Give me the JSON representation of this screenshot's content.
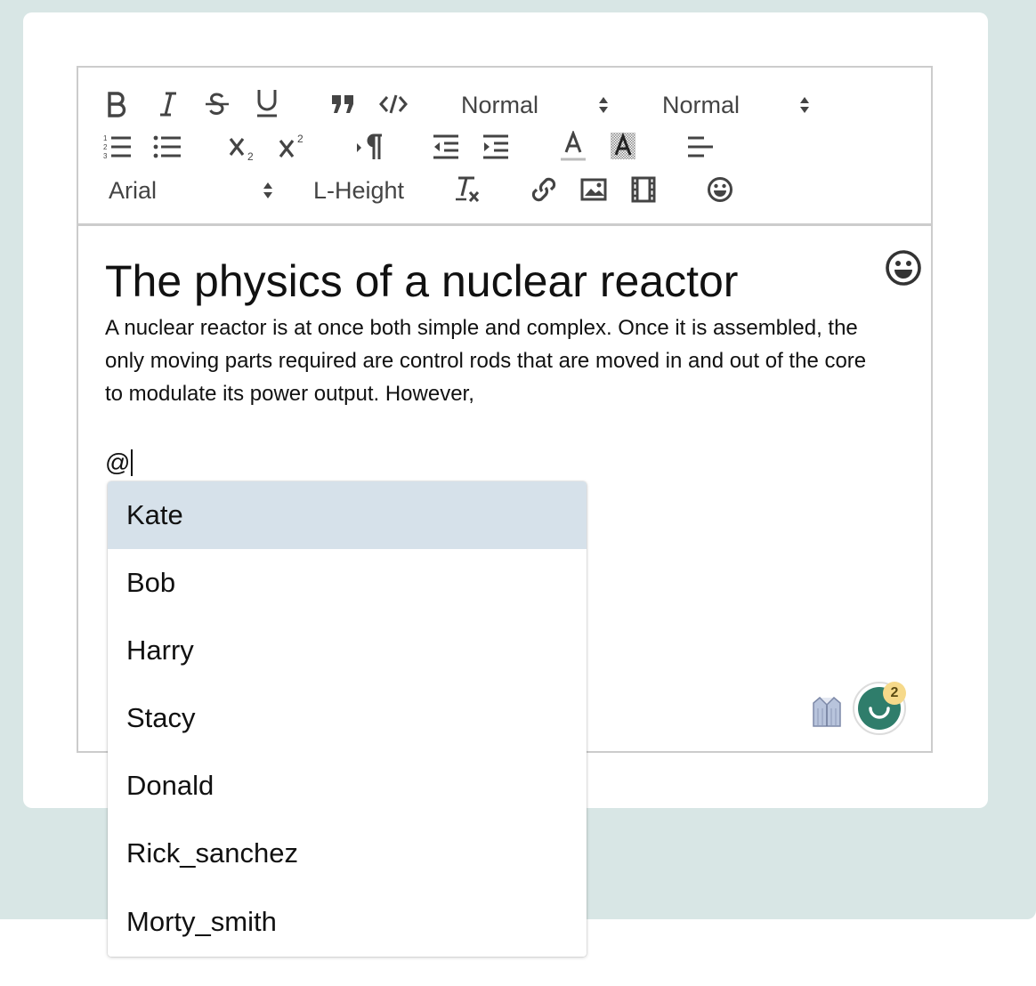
{
  "toolbar": {
    "header_select": "Normal",
    "size_select": "Normal",
    "font_select": "Arial",
    "line_height_label": "L-Height",
    "buttons": [
      "bold-icon",
      "italic-icon",
      "strikethrough-icon",
      "underline-icon",
      "blockquote-icon",
      "code-icon",
      "ordered-list-icon",
      "bullet-list-icon",
      "subscript-icon",
      "superscript-icon",
      "rtl-direction-icon",
      "outdent-icon",
      "indent-icon",
      "text-color-icon",
      "background-color-icon",
      "align-left-icon",
      "clear-format-icon",
      "link-icon",
      "image-icon",
      "video-icon",
      "emoji-icon"
    ]
  },
  "document": {
    "title": "The physics of a nuclear reactor",
    "paragraph": "A nuclear reactor is at once both simple and complex. Once it is assembled, the only moving parts required are control rods that are moved in and out of the core to modulate its power output. However,",
    "mention_trigger": "@"
  },
  "mention_dropdown": {
    "items": [
      "Kate",
      "Bob",
      "Harry",
      "Stacy",
      "Donald",
      "Rick_sanchez",
      "Morty_smith"
    ],
    "active_index": 0
  },
  "grammarly": {
    "badge_count": "2"
  },
  "colors": {
    "background": "#d8e6e5",
    "active_item": "#d6e1ea",
    "grammarly_green": "#2f7d6b",
    "badge": "#f6d98a"
  }
}
